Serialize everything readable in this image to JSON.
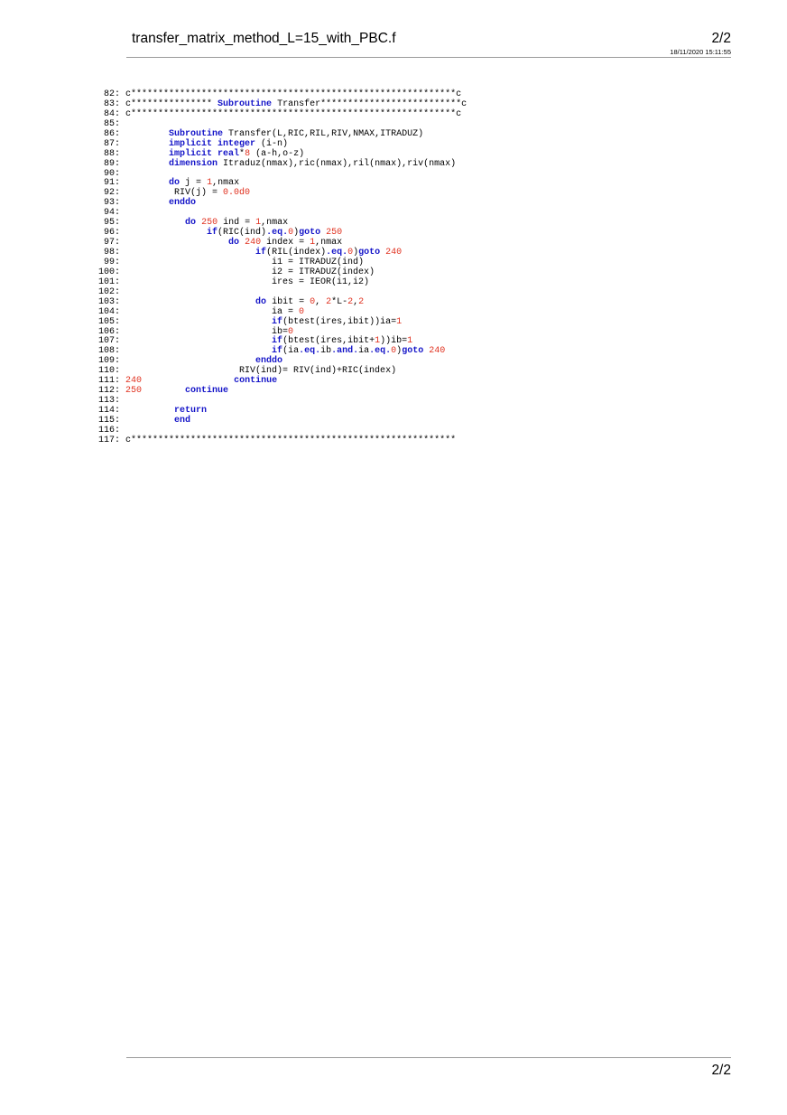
{
  "header": {
    "file_name": "transfer_matrix_method_L=15_with_PBC.f",
    "page": "2/2",
    "datetime": "18/11/2020 15:11:55"
  },
  "footer": {
    "page": "2/2"
  },
  "code_lines": [
    {
      "n": "82",
      "t": [
        [
          "c************************************************************c",
          ""
        ]
      ]
    },
    {
      "n": "83",
      "t": [
        [
          "c*************** ",
          ""
        ],
        [
          "Subroutine",
          "kw"
        ],
        [
          " Transfer**************************c",
          ""
        ]
      ]
    },
    {
      "n": "84",
      "t": [
        [
          "c************************************************************c",
          ""
        ]
      ]
    },
    {
      "n": "85",
      "t": []
    },
    {
      "n": "86",
      "t": [
        [
          "        ",
          ""
        ],
        [
          "Subroutine",
          "kw"
        ],
        [
          " Transfer(L,RIC,RIL,RIV,NMAX,ITRADUZ)",
          ""
        ]
      ]
    },
    {
      "n": "87",
      "t": [
        [
          "        ",
          ""
        ],
        [
          "implicit integer",
          "kw"
        ],
        [
          " (i-n)",
          ""
        ]
      ]
    },
    {
      "n": "88",
      "t": [
        [
          "        ",
          ""
        ],
        [
          "implicit real",
          "kw"
        ],
        [
          "*",
          ""
        ],
        [
          "8",
          "num"
        ],
        [
          " (a-h,o-z)",
          ""
        ]
      ]
    },
    {
      "n": "89",
      "t": [
        [
          "        ",
          ""
        ],
        [
          "dimension",
          "kw"
        ],
        [
          " Itraduz(nmax),ric(nmax),ril(nmax),riv(nmax)",
          ""
        ]
      ]
    },
    {
      "n": "90",
      "t": []
    },
    {
      "n": "91",
      "t": [
        [
          "        ",
          ""
        ],
        [
          "do",
          "kw"
        ],
        [
          " j = ",
          ""
        ],
        [
          "1",
          "num"
        ],
        [
          ",nmax",
          ""
        ]
      ]
    },
    {
      "n": "92",
      "t": [
        [
          "         RIV(j) = ",
          ""
        ],
        [
          "0.0d0",
          "num"
        ]
      ]
    },
    {
      "n": "93",
      "t": [
        [
          "        ",
          ""
        ],
        [
          "enddo",
          "kw"
        ]
      ]
    },
    {
      "n": "94",
      "t": []
    },
    {
      "n": "95",
      "t": [
        [
          "           ",
          ""
        ],
        [
          "do",
          "kw"
        ],
        [
          " ",
          ""
        ],
        [
          "250",
          "num"
        ],
        [
          " ind = ",
          ""
        ],
        [
          "1",
          "num"
        ],
        [
          ",nmax",
          ""
        ]
      ]
    },
    {
      "n": "96",
      "t": [
        [
          "               ",
          ""
        ],
        [
          "if",
          "kw"
        ],
        [
          "(RIC(ind)",
          ""
        ],
        [
          ".eq.",
          "kw"
        ],
        [
          "0",
          "num"
        ],
        [
          ")",
          ""
        ],
        [
          "goto",
          "kw"
        ],
        [
          " ",
          ""
        ],
        [
          "250",
          "num"
        ]
      ]
    },
    {
      "n": "97",
      "t": [
        [
          "                   ",
          ""
        ],
        [
          "do",
          "kw"
        ],
        [
          " ",
          ""
        ],
        [
          "240",
          "num"
        ],
        [
          " index = ",
          ""
        ],
        [
          "1",
          "num"
        ],
        [
          ",nmax",
          ""
        ]
      ]
    },
    {
      "n": "98",
      "t": [
        [
          "                        ",
          ""
        ],
        [
          "if",
          "kw"
        ],
        [
          "(RIL(index)",
          ""
        ],
        [
          ".eq.",
          "kw"
        ],
        [
          "0",
          "num"
        ],
        [
          ")",
          ""
        ],
        [
          "goto",
          "kw"
        ],
        [
          " ",
          ""
        ],
        [
          "240",
          "num"
        ]
      ]
    },
    {
      "n": "99",
      "t": [
        [
          "                           i1 = ITRADUZ(ind)",
          ""
        ]
      ]
    },
    {
      "n": "100",
      "t": [
        [
          "                           i2 = ITRADUZ(index)",
          ""
        ]
      ]
    },
    {
      "n": "101",
      "t": [
        [
          "                           ires = IEOR(i1,i2)",
          ""
        ]
      ]
    },
    {
      "n": "102",
      "t": []
    },
    {
      "n": "103",
      "t": [
        [
          "                        ",
          ""
        ],
        [
          "do",
          "kw"
        ],
        [
          " ibit = ",
          ""
        ],
        [
          "0",
          "num"
        ],
        [
          ", ",
          ""
        ],
        [
          "2",
          "num"
        ],
        [
          "*L-",
          ""
        ],
        [
          "2",
          "num"
        ],
        [
          ",",
          ""
        ],
        [
          "2",
          "num"
        ]
      ]
    },
    {
      "n": "104",
      "t": [
        [
          "                           ia = ",
          ""
        ],
        [
          "0",
          "num"
        ]
      ]
    },
    {
      "n": "105",
      "t": [
        [
          "                           ",
          ""
        ],
        [
          "if",
          "kw"
        ],
        [
          "(btest(ires,ibit))ia=",
          ""
        ],
        [
          "1",
          "num"
        ]
      ]
    },
    {
      "n": "106",
      "t": [
        [
          "                           ib=",
          ""
        ],
        [
          "0",
          "num"
        ]
      ]
    },
    {
      "n": "107",
      "t": [
        [
          "                           ",
          ""
        ],
        [
          "if",
          "kw"
        ],
        [
          "(btest(ires,ibit+",
          ""
        ],
        [
          "1",
          "num"
        ],
        [
          "))ib=",
          ""
        ],
        [
          "1",
          "num"
        ]
      ]
    },
    {
      "n": "108",
      "t": [
        [
          "                           ",
          ""
        ],
        [
          "if",
          "kw"
        ],
        [
          "(ia",
          ""
        ],
        [
          ".eq.",
          "kw"
        ],
        [
          "ib",
          ""
        ],
        [
          ".and.",
          "kw"
        ],
        [
          "ia",
          ""
        ],
        [
          ".eq.",
          "kw"
        ],
        [
          "0",
          "num"
        ],
        [
          ")",
          ""
        ],
        [
          "goto",
          "kw"
        ],
        [
          " ",
          ""
        ],
        [
          "240",
          "num"
        ]
      ]
    },
    {
      "n": "109",
      "t": [
        [
          "                        ",
          ""
        ],
        [
          "enddo",
          "kw"
        ]
      ]
    },
    {
      "n": "110",
      "t": [
        [
          "                     RIV(ind)= RIV(ind)+RIC(index)",
          ""
        ]
      ]
    },
    {
      "n": "111",
      "t": [
        [
          "240",
          "num"
        ],
        [
          "                 ",
          ""
        ],
        [
          "continue",
          "kw"
        ]
      ]
    },
    {
      "n": "112",
      "t": [
        [
          "250",
          "num"
        ],
        [
          "        ",
          ""
        ],
        [
          "continue",
          "kw"
        ]
      ]
    },
    {
      "n": "113",
      "t": []
    },
    {
      "n": "114",
      "t": [
        [
          "         ",
          ""
        ],
        [
          "return",
          "kw"
        ]
      ]
    },
    {
      "n": "115",
      "t": [
        [
          "         ",
          ""
        ],
        [
          "end",
          "kw"
        ]
      ]
    },
    {
      "n": "116",
      "t": []
    },
    {
      "n": "117",
      "t": [
        [
          "c************************************************************",
          ""
        ]
      ]
    }
  ]
}
